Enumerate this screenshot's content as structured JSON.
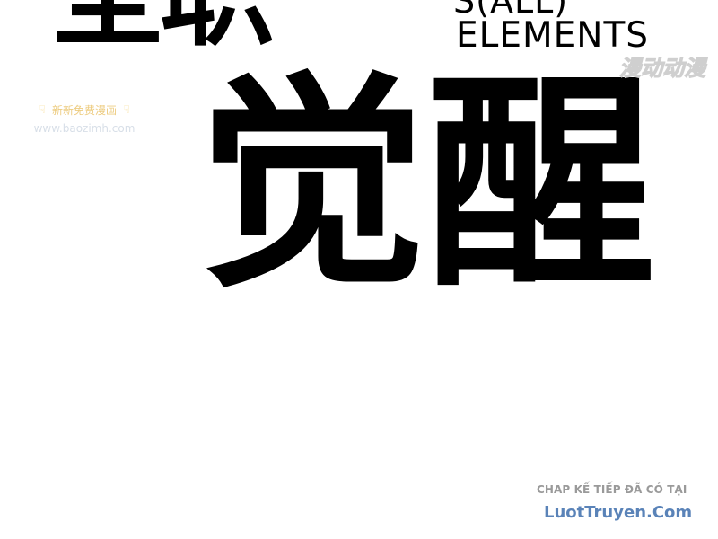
{
  "title_top": "全职",
  "subtitle_top": "S(ALL)",
  "subtitle_main": "ELEMENTS",
  "title_main": "觉醒",
  "watermarks": {
    "top_right": "漫动动漫",
    "left_line1": "新新免费漫画",
    "left_line2": "www.baozimh.com"
  },
  "footer": {
    "note": "CHAP KẾ TIẾP ĐÃ CÓ TẠI",
    "link": "LuotTruyen.Com"
  },
  "colors": {
    "text": "#000000",
    "watermark_orange": "#e0a31a",
    "watermark_blue": "#b9c6d6",
    "footer_gray": "#9a9a9a",
    "footer_link": "#5a83b8"
  },
  "icons": {
    "hand_left": "pointing-down-hand-icon",
    "hand_right": "pointing-down-hand-icon"
  }
}
